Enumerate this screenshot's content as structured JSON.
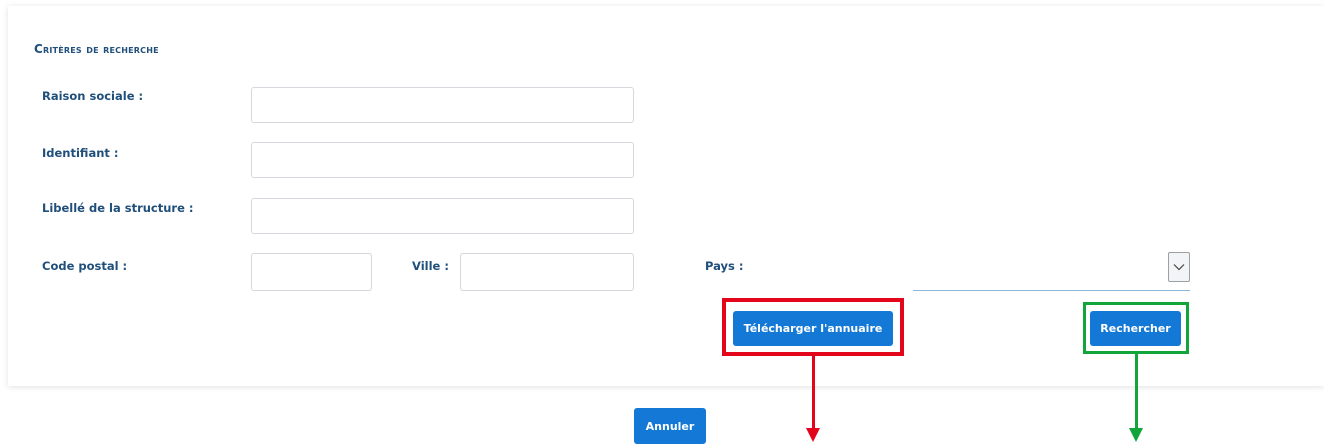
{
  "form": {
    "section_title": "Critères de recherche",
    "fields": {
      "raison_sociale": {
        "label": "Raison sociale :",
        "value": "",
        "placeholder": ""
      },
      "identifiant": {
        "label": "Identifiant :",
        "value": "",
        "placeholder": ""
      },
      "libelle_structure": {
        "label": "Libellé de la structure :",
        "value": "",
        "placeholder": ""
      },
      "code_postal": {
        "label": "Code postal :",
        "value": "",
        "placeholder": ""
      },
      "ville": {
        "label": "Ville :",
        "value": "",
        "placeholder": ""
      },
      "pays": {
        "label": "Pays :",
        "selected": ""
      }
    },
    "buttons": {
      "telecharger": "Télécharger l'annuaire",
      "rechercher": "Rechercher",
      "annuler": "Annuler"
    }
  },
  "icons": {
    "select_toggle": "chevron-down-icon"
  },
  "colors": {
    "primary_button": "#1479d6",
    "label_text": "#1f4f7a",
    "highlight_red": "#e3061b",
    "highlight_green": "#12a539",
    "input_border": "#d4d8dc",
    "select_underline": "#8fb7d9"
  }
}
